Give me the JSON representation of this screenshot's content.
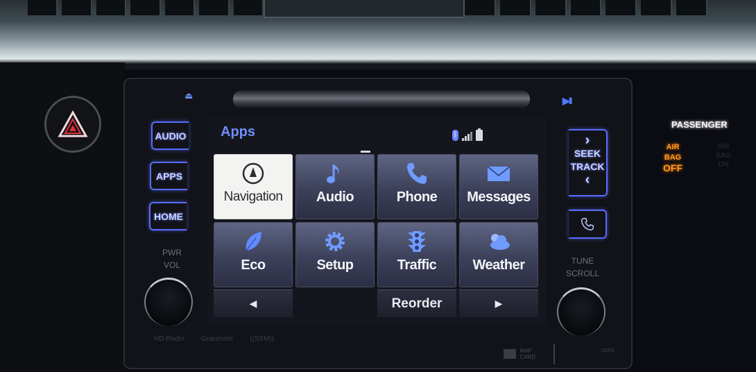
{
  "hazard_button": {
    "icon": "hazard-triangle-icon",
    "color": "#e0303a"
  },
  "head_unit": {
    "eject_icon": "⏏",
    "play_pause_icon": "▶II",
    "hard_buttons": {
      "audio": "AUDIO",
      "apps": "APPS",
      "home": "HOME"
    },
    "pwr_vol_label": [
      "PWR",
      "VOL"
    ],
    "seek_track": {
      "up": "›",
      "line1": "SEEK",
      "line2": "TRACK",
      "down": "‹"
    },
    "tune_scroll_label": [
      "TUNE",
      "SCROLL"
    ],
    "bottom_logos": [
      "HD Radio",
      "Gracenote",
      "((SXM))"
    ],
    "map_card_label": [
      "MAP",
      "CARD"
    ],
    "model_number": "10053"
  },
  "screen": {
    "title": "Apps",
    "status": {
      "bluetooth": "bluetooth-icon",
      "signal_bars": 4,
      "battery": "full"
    },
    "tiles": [
      {
        "label": "Navigation",
        "icon": "navigation-compass-icon",
        "selected": true
      },
      {
        "label": "Audio",
        "icon": "music-note-icon",
        "selected": false
      },
      {
        "label": "Phone",
        "icon": "phone-icon",
        "selected": false
      },
      {
        "label": "Messages",
        "icon": "envelope-icon",
        "selected": false
      },
      {
        "label": "Eco",
        "icon": "leaf-icon",
        "selected": false
      },
      {
        "label": "Setup",
        "icon": "gear-icon",
        "selected": false
      },
      {
        "label": "Traffic",
        "icon": "traffic-light-icon",
        "selected": false
      },
      {
        "label": "Weather",
        "icon": "weather-cloud-icon",
        "selected": false
      }
    ],
    "prev_arrow": "◀",
    "reorder_label": "Reorder",
    "next_arrow": "▶"
  },
  "passenger_airbag": {
    "title": "PASSENGER",
    "off_label": [
      "AIR BAG",
      "OFF"
    ],
    "on_label": [
      "AIR BAG",
      "ON"
    ],
    "accent": "#ff9a1f"
  },
  "colors": {
    "accent_blue": "#5a6cff",
    "title_blue": "#6f8dff"
  }
}
